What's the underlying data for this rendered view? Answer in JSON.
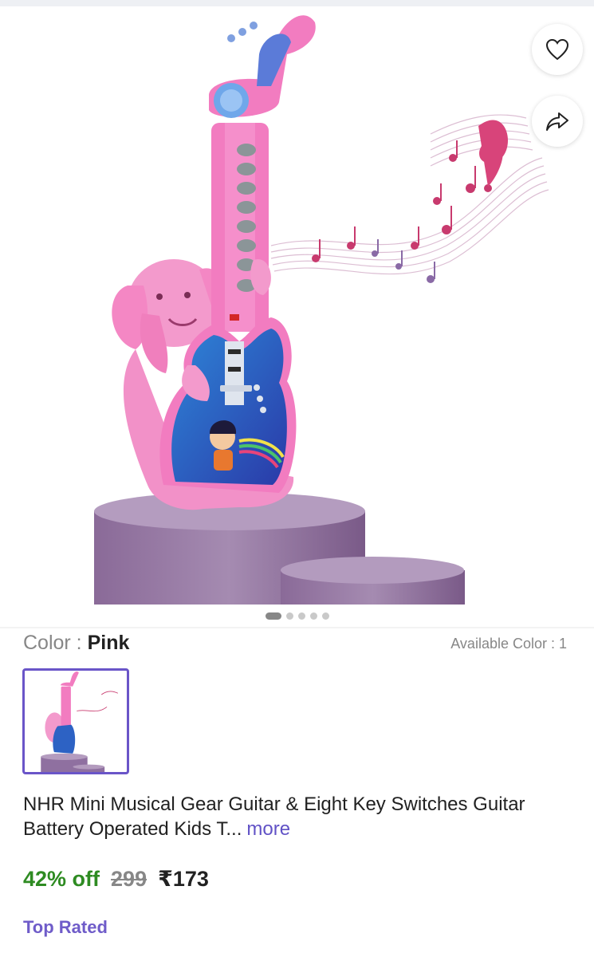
{
  "product": {
    "color_label": "Color : ",
    "color_value": "Pink",
    "available_colors": "Available Color : 1",
    "title": "NHR Mini Musical Gear Guitar & Eight Key Switches Guitar Battery Operated Kids T...",
    "more_link": "more",
    "discount": "42% off",
    "mrp": "299",
    "price": "₹173",
    "badge": "Top Rated"
  },
  "carousel": {
    "total_images": 5,
    "active_index": 0
  },
  "icons": {
    "wishlist": "heart-icon",
    "share": "share-icon"
  },
  "colors": {
    "accent": "#6a55c8",
    "discount_green": "#2e8b22",
    "guitar_pink": "#f27cc0",
    "podium_purple": "#8c6a9a"
  }
}
